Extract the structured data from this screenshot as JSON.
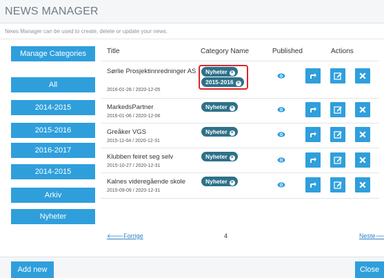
{
  "header": {
    "title": "NEWS MANAGER",
    "description": "News Manager can be used to create, delete or update your news."
  },
  "sidebar": {
    "manage_label": "Manage Categories",
    "items": [
      {
        "label": "All"
      },
      {
        "label": "2014-2015"
      },
      {
        "label": "2015-2016"
      },
      {
        "label": "2016-2017"
      },
      {
        "label": "2014-2015"
      },
      {
        "label": "Arkiv"
      },
      {
        "label": "Nyheter"
      }
    ]
  },
  "table": {
    "columns": [
      "Title",
      "Category Name",
      "Published",
      "Actions"
    ],
    "rows": [
      {
        "title": "Sørlie Prosjektinnredninger AS",
        "dates": "2016-01-28 / 2020-12-05",
        "tags": [
          "Nyheter",
          "2015-2016"
        ]
      },
      {
        "title": "MarkedsPartner",
        "dates": "2016-01-06 / 2020-12-06",
        "tags": [
          "Nyheter"
        ]
      },
      {
        "title": "Greåker VGS",
        "dates": "2015-11-04 / 2020-12-31",
        "tags": [
          "Nyheter"
        ]
      },
      {
        "title": "Klubben feiret seg selv",
        "dates": "2015-10-27 / 2020-12-31",
        "tags": [
          "Nyheter"
        ]
      },
      {
        "title": "Kalnes videregående skole",
        "dates": "2015-09-09 / 2020-12-31",
        "tags": [
          "Nyheter"
        ]
      }
    ]
  },
  "pager": {
    "prev_label": "Forrige",
    "page": "4",
    "next_label": "Neste"
  },
  "footer": {
    "add_label": "Add new",
    "close_label": "Close"
  },
  "colors": {
    "primary": "#2f9fdc",
    "tag": "#2e7189",
    "highlight": "#d9262b"
  }
}
